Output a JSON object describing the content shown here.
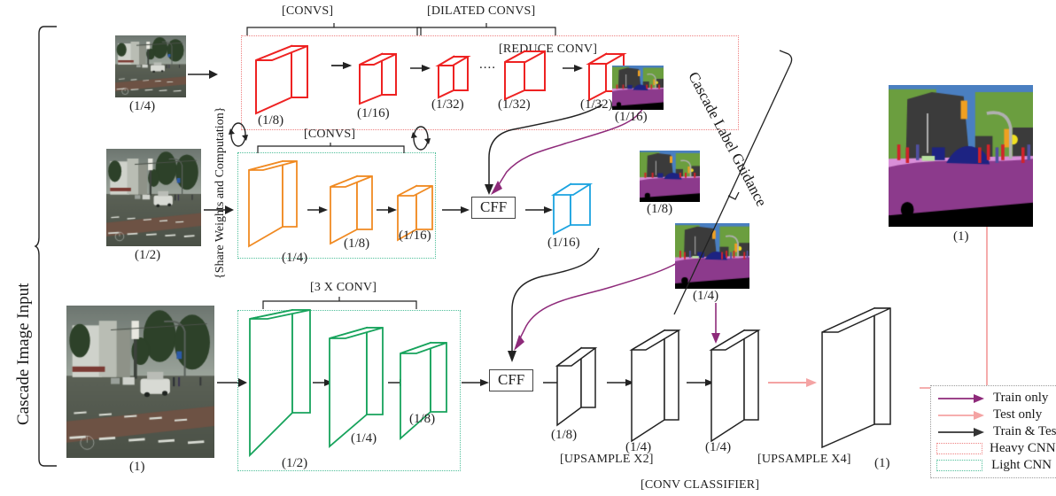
{
  "figure": {
    "title_vertical": "Cascade Image Input",
    "side_note": "{Share Weights and Computation}",
    "cascade_guidance": "Cascade Label Guidance"
  },
  "brackets": [
    {
      "name": "convs-top",
      "label": "[CONVS]"
    },
    {
      "name": "dilated-convs",
      "label": "[DILATED CONVS]"
    },
    {
      "name": "reduce-conv",
      "label": "[REDUCE CONV]"
    },
    {
      "name": "convs-mid",
      "label": "[CONVS]"
    },
    {
      "name": "three-x-conv",
      "label": "[3 X CONV]"
    },
    {
      "name": "upsample-x2",
      "label": "[UPSAMPLE X2]"
    },
    {
      "name": "upsample-x4",
      "label": "[UPSAMPLE X4]"
    },
    {
      "name": "conv-classifier",
      "label": "[CONV CLASSIFIER]"
    }
  ],
  "inputs": [
    {
      "name": "input-quarter",
      "scale": "(1/4)"
    },
    {
      "name": "input-half",
      "scale": "(1/2)"
    },
    {
      "name": "input-full",
      "scale": "(1)"
    }
  ],
  "branches": {
    "heavy_red": {
      "color": "#ee2222",
      "blocks": [
        {
          "scale": "(1/8)"
        },
        {
          "scale": "(1/16)"
        },
        {
          "scale": "(1/32)"
        },
        {
          "scale": "(1/32)"
        },
        {
          "scale": "(1/32)"
        }
      ],
      "ellipsis": "...."
    },
    "light_orange": {
      "color": "#f08a22",
      "blocks": [
        {
          "scale": "(1/4)"
        },
        {
          "scale": "(1/8)"
        },
        {
          "scale": "(1/16)"
        }
      ]
    },
    "light_green": {
      "color": "#17a35c",
      "blocks": [
        {
          "scale": "(1/2)"
        },
        {
          "scale": "(1/4)"
        },
        {
          "scale": "(1/8)"
        }
      ]
    },
    "cff_output": {
      "color": "#1ba3e0",
      "scale": "(1/16)"
    },
    "classifier": {
      "color": "#333333",
      "blocks": [
        {
          "scale": "(1/8)"
        },
        {
          "scale": "(1/4)"
        },
        {
          "scale": "(1/4)"
        },
        {
          "scale": "(1)"
        }
      ]
    }
  },
  "fusion_units": [
    {
      "name": "cff-top",
      "label": "CFF"
    },
    {
      "name": "cff-bottom",
      "label": "CFF"
    }
  ],
  "label_previews": [
    {
      "name": "label-16",
      "scale": "(1/16)"
    },
    {
      "name": "label-8",
      "scale": "(1/8)"
    },
    {
      "name": "label-4",
      "scale": "(1/4)"
    }
  ],
  "final_output": {
    "name": "final-prediction",
    "scale": "(1)"
  },
  "legend": {
    "items": [
      {
        "name": "legend-train-only",
        "label": "Train only",
        "kind": "arrow",
        "color": "#8e2a7a"
      },
      {
        "name": "legend-test-only",
        "label": "Test only",
        "kind": "arrow",
        "color": "#f4a3a3"
      },
      {
        "name": "legend-train-and-test",
        "label": "Train & Test",
        "kind": "arrow",
        "color": "#333333"
      },
      {
        "name": "legend-heavy-cnn",
        "label": "Heavy CNN",
        "kind": "dotted-box",
        "color": "#ee8080"
      },
      {
        "name": "legend-light-cnn",
        "label": "Light CNN",
        "kind": "dotted-box",
        "color": "#4fbf9a"
      }
    ]
  },
  "colors": {
    "heavy_cnn_border": "#ee8080",
    "light_cnn_border": "#4fbf9a",
    "train_only": "#8e2a7a",
    "test_only": "#f4a3a3",
    "train_test": "#333333"
  }
}
